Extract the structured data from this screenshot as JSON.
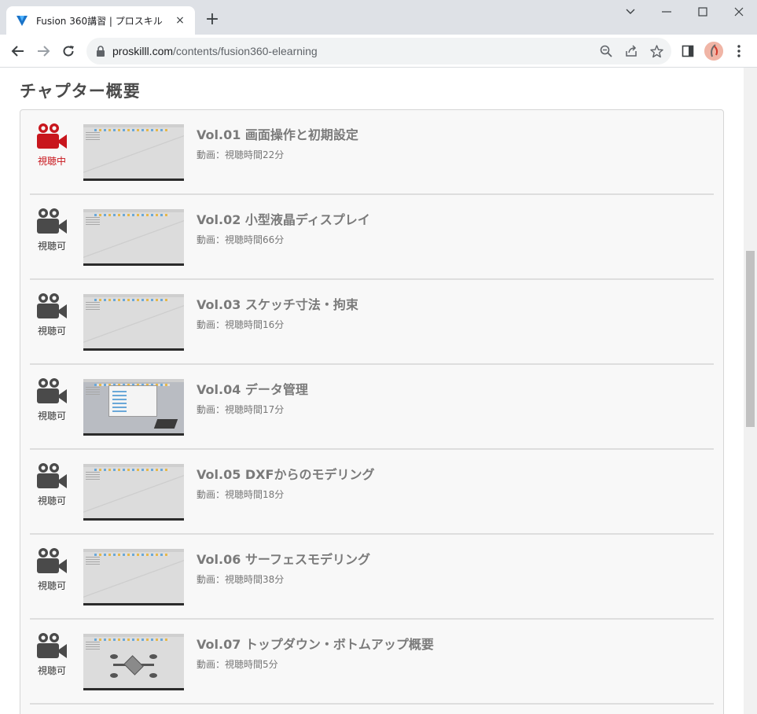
{
  "browser": {
    "tab_title": "Fusion 360講習 | プロスキル",
    "tab_close": "×",
    "new_tab": "+",
    "url_host": "proskilll.com",
    "url_path": "/contents/fusion360-elearning"
  },
  "page": {
    "section_title": "チャプター概要",
    "chapters": [
      {
        "title": "Vol.01 画面操作と初期設定",
        "duration": "動画：視聴時間22分",
        "status": "視聴中",
        "active": true,
        "thumb": "ui"
      },
      {
        "title": "Vol.02 小型液晶ディスプレイ",
        "duration": "動画：視聴時間66分",
        "status": "視聴可",
        "active": false,
        "thumb": "ui"
      },
      {
        "title": "Vol.03 スケッチ寸法・拘束",
        "duration": "動画：視聴時間16分",
        "status": "視聴可",
        "active": false,
        "thumb": "ui"
      },
      {
        "title": "Vol.04 データ管理",
        "duration": "動画：視聴時間17分",
        "status": "視聴可",
        "active": false,
        "thumb": "dialog"
      },
      {
        "title": "Vol.05 DXFからのモデリング",
        "duration": "動画：視聴時間18分",
        "status": "視聴可",
        "active": false,
        "thumb": "ui"
      },
      {
        "title": "Vol.06 サーフェスモデリング",
        "duration": "動画：視聴時間38分",
        "status": "視聴可",
        "active": false,
        "thumb": "ui"
      },
      {
        "title": "Vol.07 トップダウン・ボトムアップ概要",
        "duration": "動画：視聴時間5分",
        "status": "視聴可",
        "active": false,
        "thumb": "drone"
      }
    ]
  },
  "colors": {
    "active": "#c8161d",
    "inactive": "#4a4a4a"
  }
}
